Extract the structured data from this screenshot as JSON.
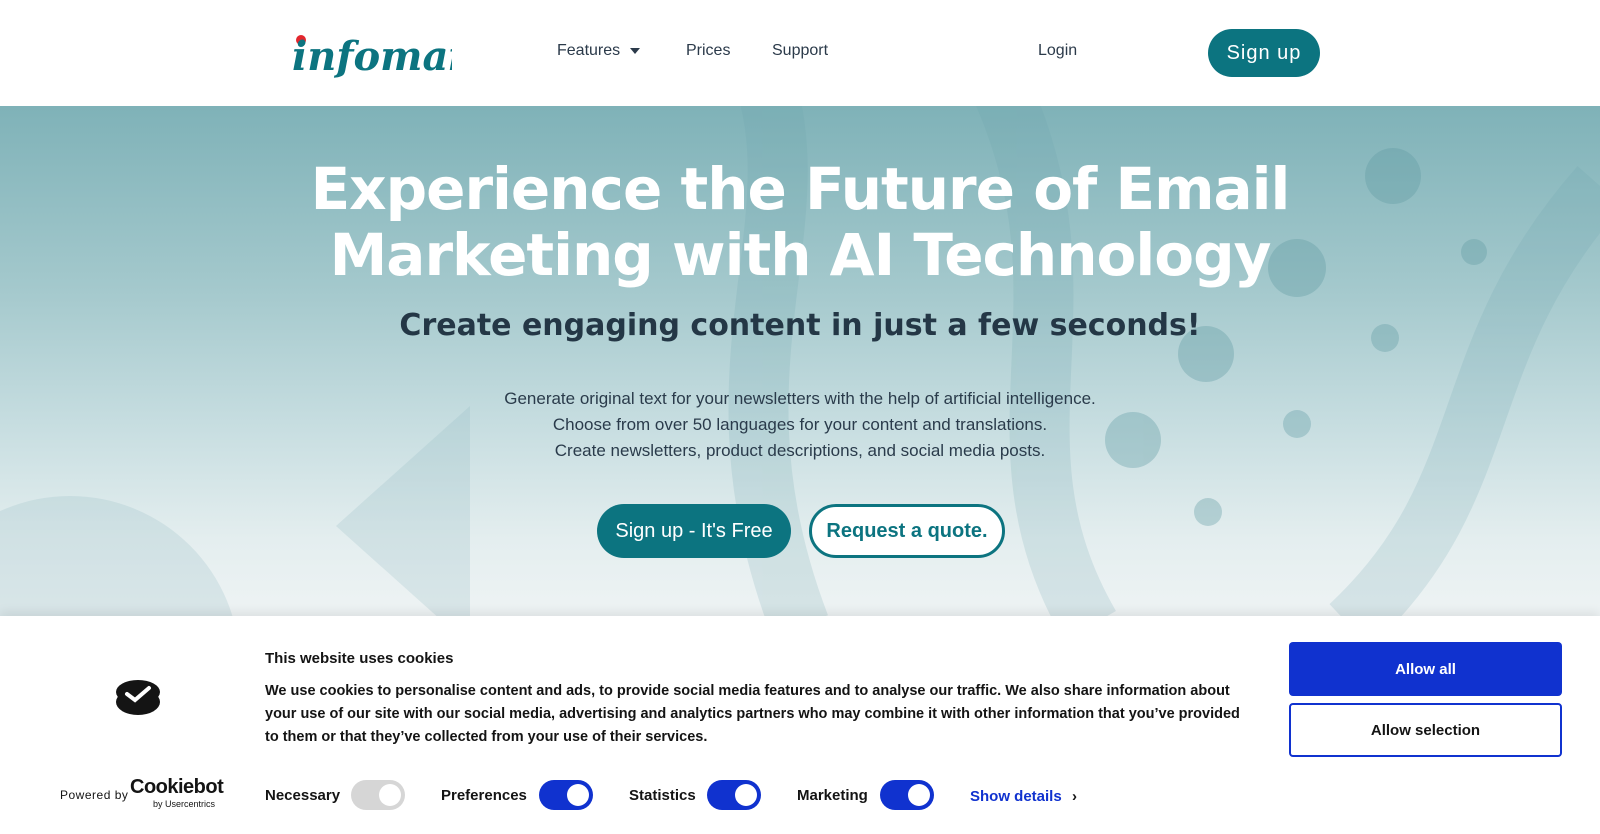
{
  "header": {
    "logo_text": "infomail",
    "nav": [
      {
        "label": "Features"
      },
      {
        "label": "Prices"
      },
      {
        "label": "Support"
      }
    ],
    "login_label": "Login",
    "signup_label": "Sign up"
  },
  "hero": {
    "title_line1": "Experience the Future of Email",
    "title_line2": "Marketing with AI Technology",
    "subtitle": "Create engaging content in just a few seconds!",
    "lines": [
      "Generate original text for your newsletters with the help of artificial intelligence.",
      "Choose from over 50 languages for your content and translations.",
      "Create newsletters, product descriptions, and social media posts."
    ],
    "primary_cta": "Sign up - It's Free",
    "secondary_cta": "Request a quote."
  },
  "cookie_banner": {
    "title": "This website uses cookies",
    "text": "We use cookies to personalise content and ads, to provide social media features and to analyse our traffic. We also share information about your use of our site with our social media, advertising and analytics partners who may combine it with other information that you’ve provided to them or that they’ve collected from your use of their services.",
    "allow_all": "Allow all",
    "allow_selection": "Allow selection",
    "options": [
      {
        "label": "Necessary",
        "checked": true,
        "disabled": true
      },
      {
        "label": "Preferences",
        "checked": true,
        "disabled": false
      },
      {
        "label": "Statistics",
        "checked": true,
        "disabled": false
      },
      {
        "label": "Marketing",
        "checked": true,
        "disabled": false
      }
    ],
    "show_details": "Show details",
    "powered_by": "Powered by",
    "brand": "Cookiebot",
    "brand_sub": "by Usercentrics"
  },
  "colors": {
    "brand_teal": "#0c7480",
    "logo_dot": "#e3262d",
    "cookie_blue": "#1032cf"
  },
  "icons": {
    "features_dropdown": "chevron-down-icon",
    "show_details": "chevron-right-icon",
    "cookiebot": "cookiebot-logo-icon"
  }
}
